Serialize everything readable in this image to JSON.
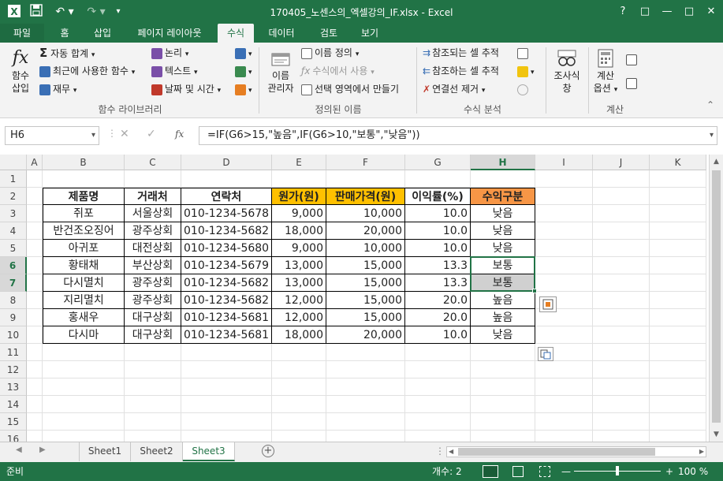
{
  "window": {
    "title": "170405_노센스의_엑셀강의_IF.xlsx - Excel",
    "help": "?",
    "restore": "□",
    "minimize": "—",
    "maximize": "□",
    "close": "✕"
  },
  "tabs": [
    "파일",
    "홈",
    "삽입",
    "페이지 레이아웃",
    "수식",
    "데이터",
    "검토",
    "보기"
  ],
  "ribbon": {
    "insert_function": [
      "함수",
      "삽입"
    ],
    "autosum": "자동 합계",
    "recent": "최근에 사용한 함수",
    "financial": "재무",
    "logical": "논리",
    "text": "텍스트",
    "datetime": "날짜 및 시간",
    "group_function_library": "함수 라이브러리",
    "name_manager": [
      "이름",
      "관리자"
    ],
    "define_name": "이름 정의",
    "use_in_formula": "수식에서 사용",
    "create_from_selection": "선택 영역에서 만들기",
    "group_defined_names": "정의된 이름",
    "trace_precedents": "참조되는 셀 추적",
    "trace_dependents": "참조하는 셀 추적",
    "remove_arrows": "연결선 제거",
    "group_formula_auditing": "수식 분석",
    "watch_window": [
      "조사식",
      "창"
    ],
    "calc_options": [
      "계산",
      "옵션"
    ],
    "group_calculation": "계산"
  },
  "formula_bar": {
    "name_box": "H6",
    "formula": "=IF(G6>15,\"높음\",IF(G6>10,\"보통\",\"낮음\"))"
  },
  "columns": [
    "A",
    "B",
    "C",
    "D",
    "E",
    "F",
    "G",
    "H",
    "I",
    "J",
    "K"
  ],
  "rows": [
    "1",
    "2",
    "3",
    "4",
    "5",
    "6",
    "7",
    "8",
    "9",
    "10",
    "11",
    "12",
    "13",
    "14",
    "15",
    "16"
  ],
  "table": {
    "headers": [
      "제품명",
      "거래처",
      "연락처",
      "원가(원)",
      "판매가격(원)",
      "이익률(%)",
      "수익구분"
    ],
    "rows": [
      [
        "쥐포",
        "서울상회",
        "010-1234-5678",
        "9,000",
        "10,000",
        "10.0",
        "낮음"
      ],
      [
        "반건조오징어",
        "광주상회",
        "010-1234-5682",
        "18,000",
        "20,000",
        "10.0",
        "낮음"
      ],
      [
        "아귀포",
        "대전상회",
        "010-1234-5680",
        "9,000",
        "10,000",
        "10.0",
        "낮음"
      ],
      [
        "황태채",
        "부산상회",
        "010-1234-5679",
        "13,000",
        "15,000",
        "13.3",
        "보통"
      ],
      [
        "다시멸치",
        "광주상회",
        "010-1234-5682",
        "13,000",
        "15,000",
        "13.3",
        "보통"
      ],
      [
        "지리멸치",
        "광주상회",
        "010-1234-5682",
        "12,000",
        "15,000",
        "20.0",
        "높음"
      ],
      [
        "홍새우",
        "대구상회",
        "010-1234-5681",
        "12,000",
        "15,000",
        "20.0",
        "높음"
      ],
      [
        "다시마",
        "대구상회",
        "010-1234-5681",
        "18,000",
        "20,000",
        "10.0",
        "낮음"
      ]
    ]
  },
  "sheets": [
    "Sheet1",
    "Sheet2",
    "Sheet3"
  ],
  "status": {
    "ready": "준비",
    "count": "개수: 2",
    "zoom": "100 %"
  },
  "colors": {
    "excel_green": "#217346",
    "header_yellow": "#ffc000",
    "header_orange": "#f79646",
    "selected_fill": "#d0d0d0"
  }
}
